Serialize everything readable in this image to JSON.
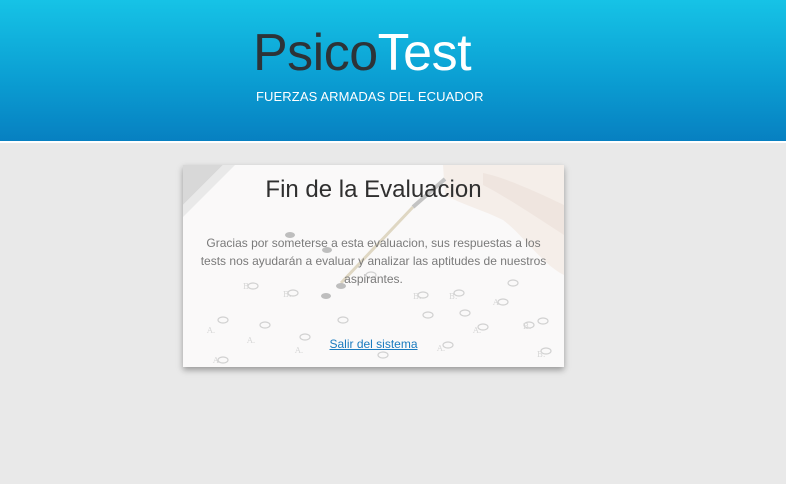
{
  "header": {
    "logo_part1": "Psico",
    "logo_part2": "Test",
    "subtitle": "FUERZAS ARMADAS DEL ECUADOR"
  },
  "card": {
    "title": "Fin de la Evaluacion",
    "message": "Gracias por someterse a esta evaluacion, sus respuestas a los tests nos ayudarán a evaluar y analizar las aptitudes de nuestros aspirantes.",
    "logout_link": "Salir del sistema"
  },
  "colors": {
    "header_top": "#16c3e6",
    "header_bottom": "#0780c1",
    "logo_dark": "#2d3338",
    "link": "#1a7bbf",
    "page_background": "#e9e9e9"
  }
}
